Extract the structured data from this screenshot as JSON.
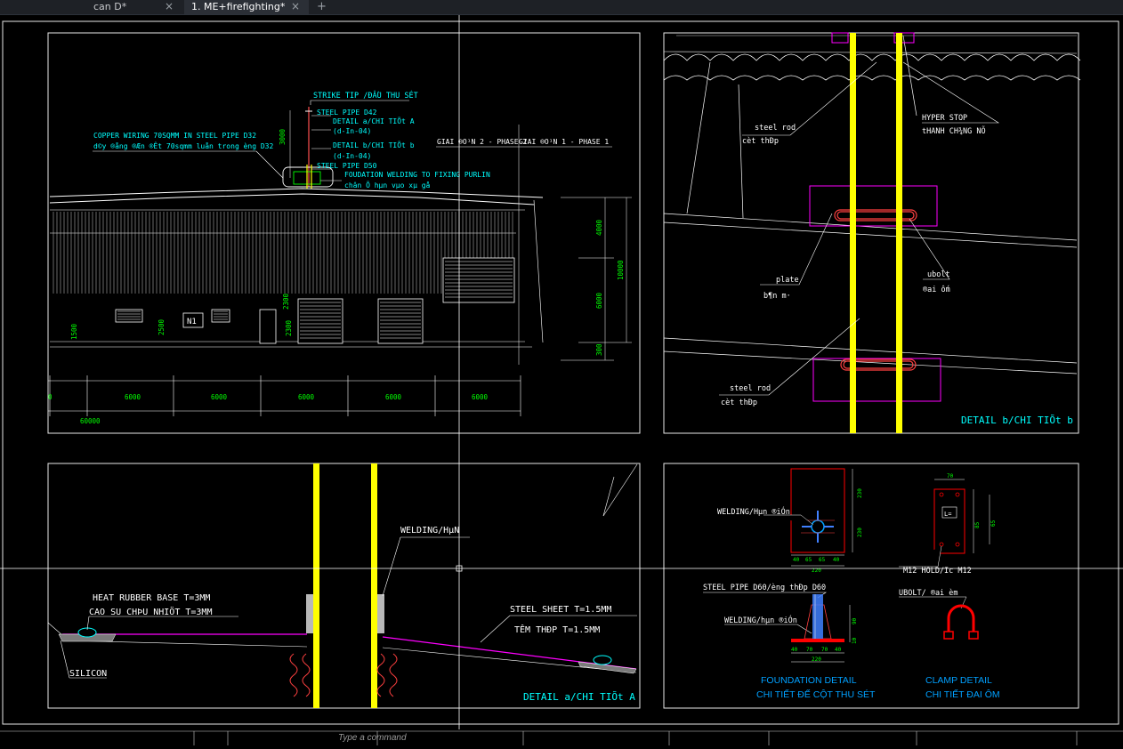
{
  "tabs": [
    {
      "label": "can D*",
      "close": "×"
    },
    {
      "label": "1. ME+firefighting*",
      "close": "×"
    }
  ],
  "new_tab_label": "+",
  "elevation": {
    "labels": {
      "strike_tip": "STRIKE TIP /ĐẦU THU SÉT",
      "steel_pipe_d42": "STEEL PIPE D42",
      "detail_a": "DETAIL a/CHI TIÕt A",
      "detail_a_ref": "(d-In-04)",
      "detail_b": "DETAIL b/CHI TIÕt b",
      "detail_b_ref": "(d-In-04)",
      "steel_pipe_d50": "STEEL PIPE D50",
      "foundation_welding": "FOUDATION WELDING TO FIXING PURLIN",
      "foundation_welding_vn": "chân Õ hµn vµo xµ gå",
      "copper_wiring": "COPPER WIRING 70SQMM IN STEEL PIPE D32",
      "copper_wiring_vn": "d©y ®ång ®Æn ®Êt 70sqmm luån trong èng D32",
      "phase_2": "GIAI ®O¹N 2 - PHASE 2",
      "phase_1": "GIAI ®O¹N 1 - PHASE 1",
      "grid_label": "N1"
    },
    "dims_v": [
      "3000",
      "4000",
      "10000",
      "6000",
      "300",
      "2500",
      "1500",
      "2300",
      "2300"
    ],
    "dims_h": [
      "6000",
      "6000",
      "6000",
      "6000",
      "6000"
    ],
    "dim_total": "60000",
    "dim_zero": "0"
  },
  "detail_b": {
    "title": "DETAIL b/CHI TIÕt b",
    "labels": {
      "hyper_stop": "HYPER STOP",
      "hyper_stop_vn": "tHANH CH¾NG NÕ",
      "steel_rod_1": "steel rod",
      "steel_rod_1_vn": "cèt thÐp",
      "plate": "plate",
      "plate_vn": "b¶n m·",
      "ubolt": "ubolt",
      "ubolt_vn": "®ai ốm",
      "steel_rod_2": "steel rod",
      "steel_rod_2_vn": "cèt thÐp"
    }
  },
  "detail_a": {
    "title": "DETAIL a/CHI TIÕt A",
    "labels": {
      "welding": "WELDING/HµN",
      "heat_rubber": "HEAT RUBBER BASE T=3MM",
      "heat_rubber_vn": "CAO SU CHÞU NHIÖT T=3MM",
      "silicon": "SILICON",
      "steel_sheet": "STEEL SHEET T=1.5MM",
      "steel_sheet_vn": "TÊM THÐP T=1.5MM"
    }
  },
  "foundation": {
    "welding_top": "WELDING/Hµn ®iÓn",
    "dims_top": [
      "40",
      "65",
      "65",
      "40"
    ],
    "dim_top_total": "220",
    "dims_v": [
      "230",
      "230"
    ],
    "steel_pipe": "STEEL PIPE D60/èng thÐp D60",
    "welding_bottom": "WELDING/hµn ®iÓn",
    "dims_bottom": [
      "40",
      "70",
      "70",
      "40"
    ],
    "dim_bottom_total": "220",
    "dims_bottom_v": [
      "90",
      "10"
    ],
    "title": "FOUNDATION DETAIL",
    "title_vn": "CHI TIẾT ĐẾ CỘT THU SÉT"
  },
  "clamp": {
    "m12": "M12 HOLD/Ic M12",
    "ubolt": "UBOLT/ ®ai èm",
    "dims": [
      "70",
      "85",
      "65"
    ],
    "label_l": "L=",
    "title": "CLAMP DETAIL",
    "title_vn": "CHI TIẾT ĐAI ÔM"
  },
  "colors": {
    "yellow": "#ffff00",
    "magenta": "#ff00ff",
    "cyan": "#00ffff",
    "red": "#ff0000",
    "green": "#00ff00",
    "white": "#ffffff",
    "blue_title": "#00a0ff"
  },
  "command_line": "Type a command"
}
